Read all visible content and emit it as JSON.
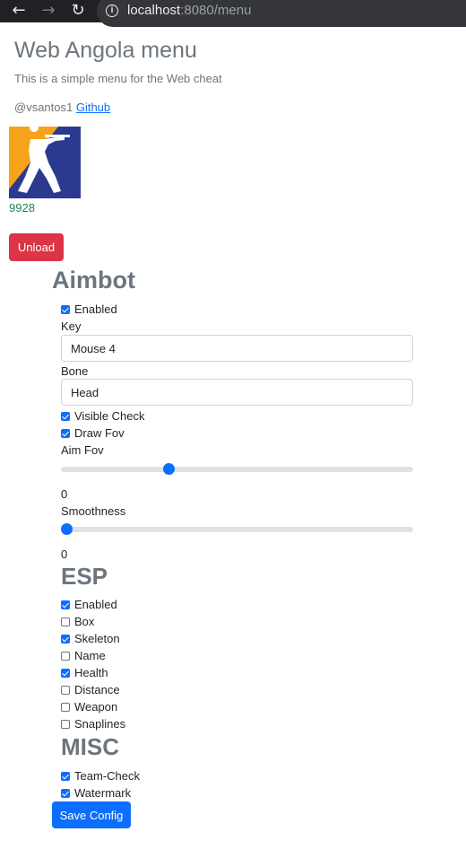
{
  "browser": {
    "back_icon": "←",
    "forward_icon": "→",
    "reload_icon": "↻",
    "url_host": "localhost",
    "url_path": ":8080/menu"
  },
  "header": {
    "title": "Web Angola menu",
    "subtitle": "This is a simple menu for the Web cheat",
    "author": "@vsantos1 ",
    "github_link": "Github",
    "user_id": "9928",
    "unload_label": "Unload"
  },
  "aimbot": {
    "title": "Aimbot",
    "enabled_label": "Enabled",
    "enabled": true,
    "key_label": "Key",
    "key_value": "Mouse 4",
    "bone_label": "Bone",
    "bone_value": "Head",
    "visible_check_label": "Visible Check",
    "visible_check": true,
    "draw_fov_label": "Draw Fov",
    "draw_fov": true,
    "aim_fov_label": "Aim Fov",
    "aim_fov_value": "0",
    "aim_fov_fill": 0.3,
    "smoothness_label": "Smoothness",
    "smoothness_value": "0",
    "smoothness_fill": 0.0
  },
  "esp": {
    "title": "ESP",
    "options": [
      {
        "label": "Enabled",
        "checked": true
      },
      {
        "label": "Box",
        "checked": false
      },
      {
        "label": "Skeleton",
        "checked": true
      },
      {
        "label": "Name",
        "checked": false
      },
      {
        "label": "Health",
        "checked": true
      },
      {
        "label": "Distance",
        "checked": false
      },
      {
        "label": "Weapon",
        "checked": false
      },
      {
        "label": "Snaplines",
        "checked": false
      }
    ]
  },
  "misc": {
    "title": "MISC",
    "options": [
      {
        "label": "Team-Check",
        "checked": true
      },
      {
        "label": "Watermark",
        "checked": true
      }
    ]
  },
  "save_label": "Save Config",
  "colors": {
    "unload": "#dc3545",
    "primary": "#0d6efd",
    "user_id": "#198754",
    "logo_orange": "#f7a21b",
    "logo_blue": "#2b3a8f"
  }
}
